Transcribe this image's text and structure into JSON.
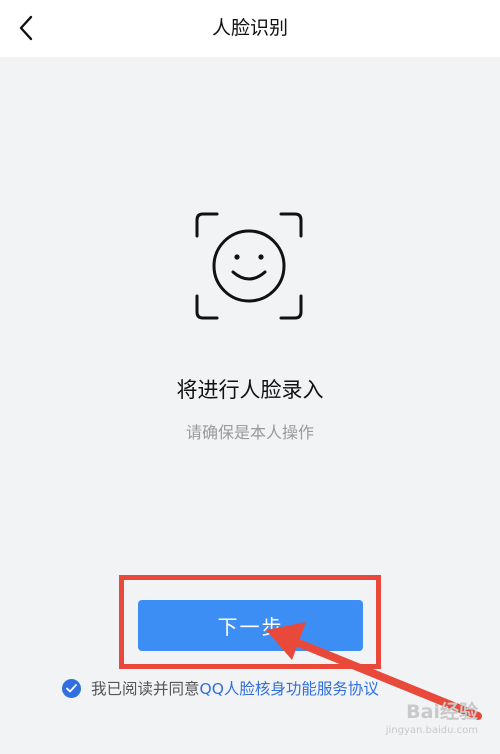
{
  "nav": {
    "back_icon": "chevron-left-icon",
    "title": "人脸识别"
  },
  "face_icon": "face-scan-icon",
  "main": {
    "heading": "将进行人脸录入",
    "subheading": "请确保是本人操作"
  },
  "next_button": {
    "label": "下一步",
    "color": "#3d8ef4"
  },
  "agreement": {
    "checked": true,
    "text": "我已阅读并同意",
    "link": "QQ人脸核身功能服务协议",
    "link_color": "#2f6fe0"
  },
  "annotation": {
    "highlight_color": "#e8493b"
  },
  "watermark": {
    "brand": "Bai经验",
    "url": "jingyan.baidu.com"
  }
}
